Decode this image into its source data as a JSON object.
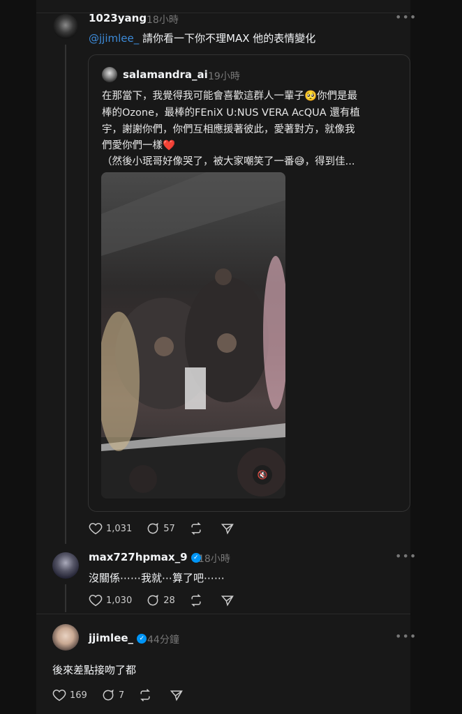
{
  "post1": {
    "username": "1023yang",
    "time": "18小時",
    "mention": "@jjimlee_",
    "text": " 請你看一下你不理MAX 他的表情變化",
    "likes": "1,031",
    "comments": "57"
  },
  "quote": {
    "username": "salamandra_ai",
    "time": "19小時",
    "lines": [
      "在那當下，我覺得我可能會喜歡這群人一輩子🥺你們是最",
      "棒的Ozone，最棒的FEniX U:NUS VERA AcQUA 還有植",
      "宇，謝謝你們，你們互相應援著彼此，愛著對方，就像我",
      "們愛你們一樣❤️",
      "（然後小珉哥好像哭了，被大家嘲笑了一番😅，得到佳..."
    ]
  },
  "post2": {
    "username": "max727hpmax_9",
    "time": "18小時",
    "text": "沒關係⋯⋯我就⋯算了吧⋯⋯",
    "likes": "1,030",
    "comments": "28"
  },
  "post3": {
    "username": "jjimlee_",
    "time": "44分鐘",
    "text": "後來差點接吻了都",
    "likes": "169",
    "comments": "7"
  },
  "more_label": "•••",
  "mute_icon": "🔇",
  "verified_mark": "✓"
}
